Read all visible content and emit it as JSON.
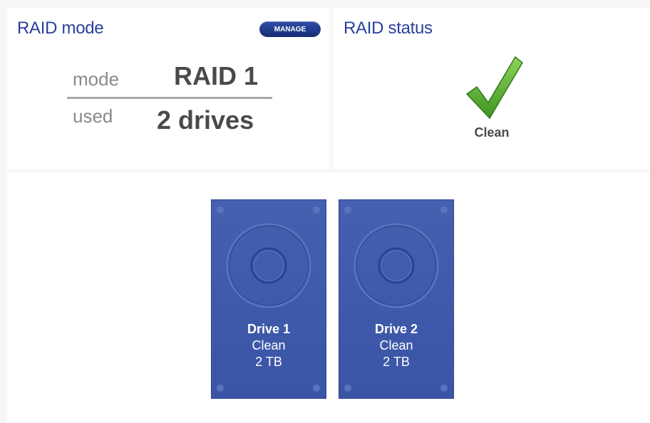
{
  "raid_mode_panel": {
    "title": "RAID mode",
    "manage_label": "MANAGE",
    "mode_label": "mode",
    "mode_value": "RAID 1",
    "used_label": "used",
    "used_value": "2 drives"
  },
  "raid_status_panel": {
    "title": "RAID status",
    "status_icon": "checkmark-icon",
    "status_text": "Clean",
    "status_color": "#5cb030"
  },
  "drives": [
    {
      "name": "Drive 1",
      "status": "Clean",
      "capacity": "2 TB"
    },
    {
      "name": "Drive 2",
      "status": "Clean",
      "capacity": "2 TB"
    }
  ],
  "colors": {
    "accent": "#2a3f9c",
    "drive_fill": "#4258ab"
  }
}
